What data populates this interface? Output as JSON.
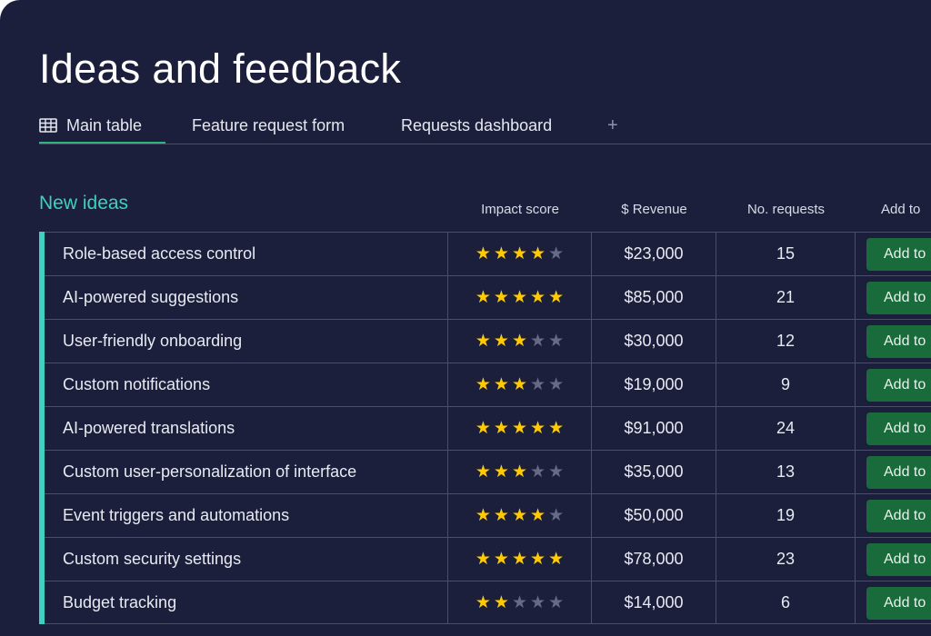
{
  "board": {
    "title": "Ideas and feedback",
    "tabs": [
      {
        "label": "Main table",
        "icon": "table-icon",
        "active": true
      },
      {
        "label": "Feature request form"
      },
      {
        "label": "Requests dashboard"
      }
    ],
    "add_tab": "+"
  },
  "group": {
    "title": "New ideas",
    "accent": "#3ed0c0",
    "columns": {
      "impact": "Impact score",
      "revenue": "$ Revenue",
      "requests": "No. requests",
      "add": "Add to"
    },
    "rows": [
      {
        "name": "Role-based access control",
        "stars": 4,
        "revenue": "$23,000",
        "requests": "15",
        "button": "Add to"
      },
      {
        "name": "AI-powered suggestions",
        "stars": 5,
        "revenue": "$85,000",
        "requests": "21",
        "button": "Add to"
      },
      {
        "name": "User-friendly onboarding",
        "stars": 3,
        "revenue": "$30,000",
        "requests": "12",
        "button": "Add to"
      },
      {
        "name": "Custom notifications",
        "stars": 3,
        "revenue": "$19,000",
        "requests": "9",
        "button": "Add to"
      },
      {
        "name": "AI-powered translations",
        "stars": 5,
        "revenue": "$91,000",
        "requests": "24",
        "button": "Add to"
      },
      {
        "name": "Custom user-personalization of interface",
        "stars": 3,
        "revenue": "$35,000",
        "requests": "13",
        "button": "Add to"
      },
      {
        "name": "Event triggers and automations",
        "stars": 4,
        "revenue": "$50,000",
        "requests": "19",
        "button": "Add to"
      },
      {
        "name": "Custom security settings",
        "stars": 5,
        "revenue": "$78,000",
        "requests": "23",
        "button": "Add to"
      },
      {
        "name": "Budget tracking",
        "stars": 2,
        "revenue": "$14,000",
        "requests": "6",
        "button": "Add to"
      }
    ],
    "max_stars": 5
  },
  "colors": {
    "background": "#1c1f3b",
    "star_on": "#ffcb00",
    "star_off": "#676a85",
    "button": "#1a6b3c",
    "tab_underline": "#2fb37a"
  }
}
